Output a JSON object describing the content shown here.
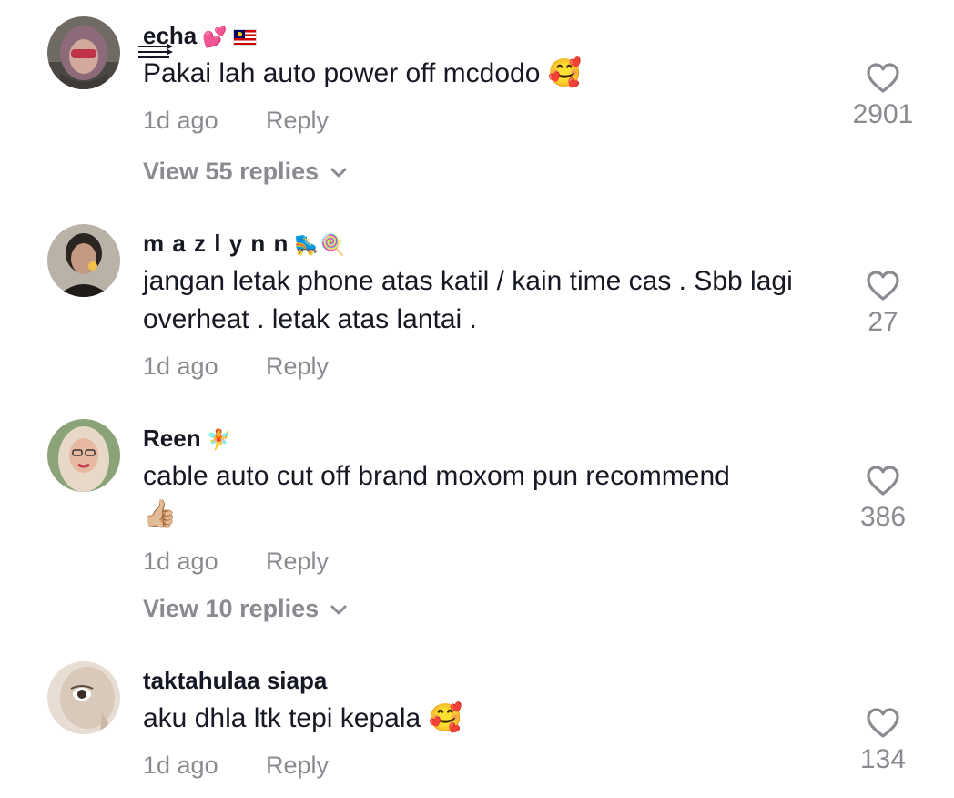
{
  "comments": [
    {
      "username": "echa",
      "username_emoji": "💕",
      "text": "Pakai lah auto power off mcdodo",
      "text_emoji": "🥰",
      "time": "1d ago",
      "reply_label": "Reply",
      "likes": "2901",
      "view_replies": "View 55 replies"
    },
    {
      "username": "m a z l y n n",
      "username_emoji": "🛼🍭",
      "text": "jangan letak phone atas katil / kain time cas . Sbb lagi overheat . letak atas lantai .",
      "time": "1d ago",
      "reply_label": "Reply",
      "likes": "27"
    },
    {
      "username": "Reen",
      "username_emoji": "🧚",
      "text": "cable auto cut off brand moxom pun recommend",
      "text_emoji": "👍🏼",
      "time": "1d ago",
      "reply_label": "Reply",
      "likes": "386",
      "view_replies": "View 10 replies"
    },
    {
      "username": "taktahulaa siapa",
      "text": "aku dhla ltk tepi kepala",
      "text_emoji": "🥰",
      "time": "1d ago",
      "reply_label": "Reply",
      "likes": "134"
    }
  ],
  "icons": {
    "like": "heart-outline-icon",
    "expand": "chevron-down-icon",
    "flag": "malaysia-flag-icon"
  },
  "colors": {
    "text": "#161823",
    "muted": "#8a8b91",
    "background": "#ffffff"
  }
}
